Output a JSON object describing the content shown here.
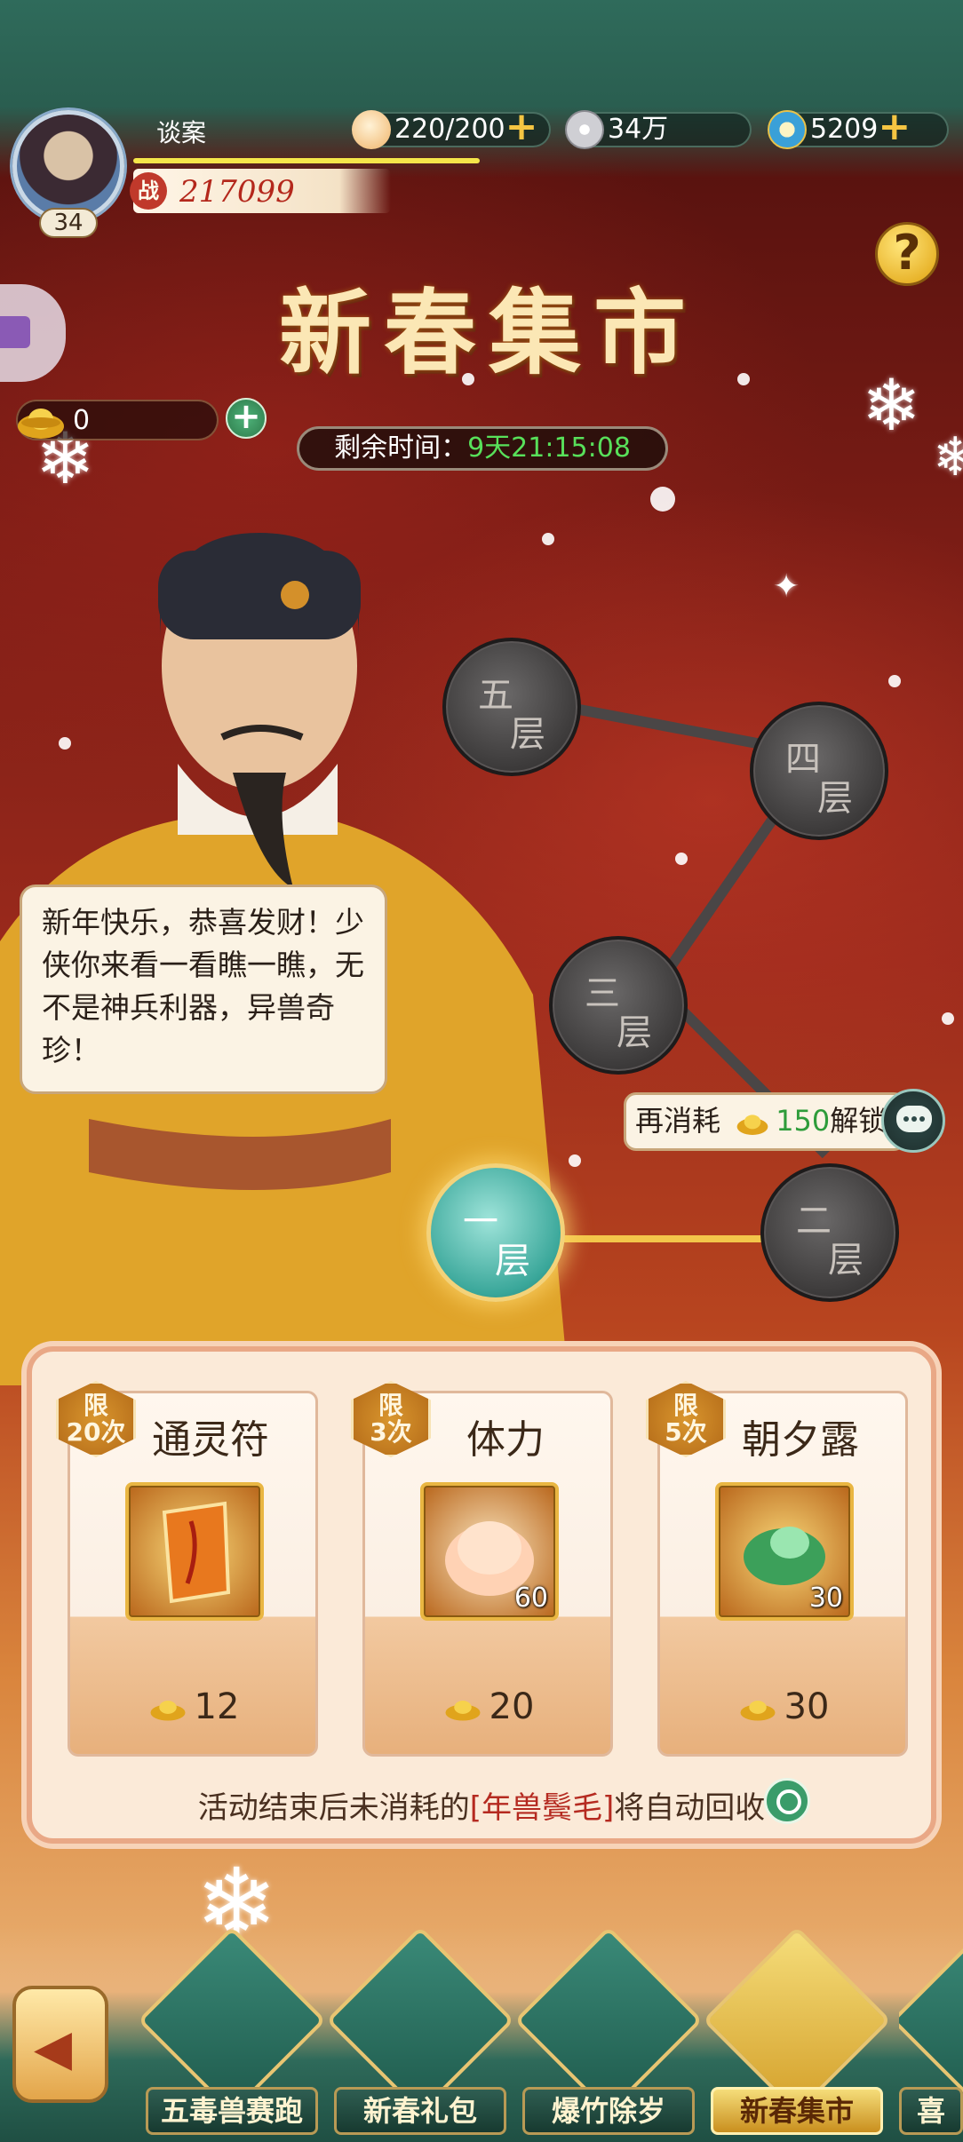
{
  "player": {
    "name": "谈案",
    "level": "34",
    "power": "217099",
    "power_badge": "战"
  },
  "resources": {
    "stamina": "220/200",
    "silver": "34万",
    "jade": "5209"
  },
  "event": {
    "title": "新春集市",
    "timer_label": "剩余时间：",
    "timer_value": "9天21:15:08",
    "currency_amount": "0"
  },
  "npc": {
    "speech": "新年快乐，恭喜发财！少侠你来看一看瞧一瞧，无不是神兵利器，异兽奇珍！"
  },
  "floors": [
    {
      "a": "五",
      "b": "层"
    },
    {
      "a": "四",
      "b": "层"
    },
    {
      "a": "三",
      "b": "层"
    },
    {
      "a": "二",
      "b": "层"
    },
    {
      "a": "一",
      "b": "层"
    }
  ],
  "unlock_tip": {
    "prefix": "再消耗",
    "amount": "150",
    "suffix": "解锁"
  },
  "shop": {
    "items": [
      {
        "limit_a": "限",
        "limit_b": "20次",
        "name": "通灵符",
        "count": "",
        "price": "12"
      },
      {
        "limit_a": "限",
        "limit_b": "3次",
        "name": "体力",
        "count": "60",
        "price": "20"
      },
      {
        "limit_a": "限",
        "limit_b": "5次",
        "name": "朝夕露",
        "count": "30",
        "price": "30"
      }
    ],
    "notice_pre": "活动结束后未消耗的",
    "notice_hl": "[年兽鬓毛]",
    "notice_post": "将自动回收"
  },
  "bottom_tabs": [
    {
      "label": "五毒兽赛跑"
    },
    {
      "label": "新春礼包"
    },
    {
      "label": "爆竹除岁"
    },
    {
      "label": "新春集市"
    },
    {
      "label": "喜"
    }
  ],
  "icons": {
    "avatar": "avatar-icon",
    "stamina": "bun-icon",
    "silver": "coin-icon",
    "jade": "jade-icon",
    "help": "question-icon",
    "currency": "gold-ingot-icon",
    "chat": "chat-icon",
    "search": "search-icon",
    "back": "back-arrow-icon"
  }
}
